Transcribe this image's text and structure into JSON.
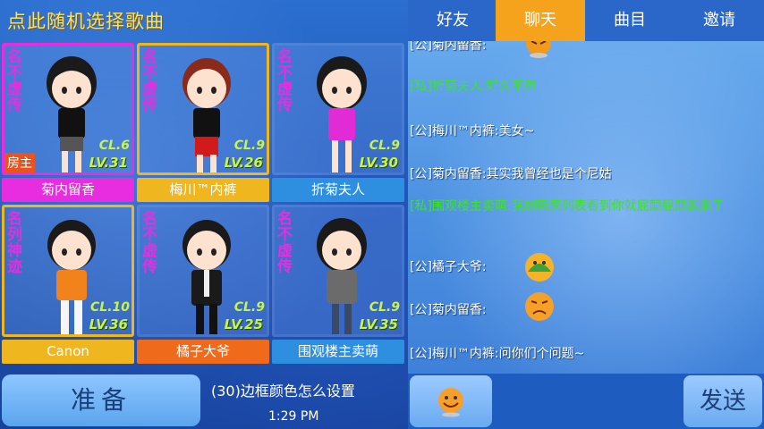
{
  "header": {
    "random_song_label": "点此随机选择歌曲"
  },
  "players": [
    {
      "vertical_tag": "名不虚传",
      "cl": "CL.6",
      "lv": "LV.31",
      "host": "房主",
      "name": "菊内留香"
    },
    {
      "vertical_tag": "名不虚传",
      "cl": "CL.9",
      "lv": "LV.26",
      "name": "梅川™内裤"
    },
    {
      "vertical_tag": "名不虚传",
      "cl": "CL.9",
      "lv": "LV.30",
      "name": "折菊夫人"
    },
    {
      "vertical_tag": "名列神迹",
      "cl": "CL.10",
      "lv": "LV.36",
      "name": "Canon"
    },
    {
      "vertical_tag": "名不虚传",
      "cl": "CL.9",
      "lv": "LV.25",
      "name": "橘子大爷"
    },
    {
      "vertical_tag": "名不虚传",
      "cl": "CL.9",
      "lv": "LV.35",
      "name": "围观楼主卖萌"
    }
  ],
  "footer": {
    "ready_label": "准备",
    "song_info": "(30)边框颜色怎么设置",
    "time": "1:29 PM"
  },
  "tabs": [
    {
      "label": "好友"
    },
    {
      "label": "聊天"
    },
    {
      "label": "曲目"
    },
    {
      "label": "邀请"
    }
  ],
  "chat": {
    "messages": [
      {
        "text": "[公]菊内留香:"
      },
      {
        "text": "[私]折菊夫人:好久不见"
      },
      {
        "text": "[公]梅川™内裤:美女~"
      },
      {
        "text": "[公]菊内留香:其实我曾经也是个尼姑"
      },
      {
        "text": "[私]围观楼主卖萌:我翻玩家列表看到你就屁颠屁颠跑来了"
      },
      {
        "text": "[公]橘子大爷:"
      },
      {
        "text": "[公]菊内留香:"
      },
      {
        "text": "[公]梅川™内裤:问你们个问题~"
      }
    ],
    "send_label": "发送"
  },
  "colors": {
    "pink": "#e82de0",
    "gold": "#f0b61f",
    "active_tab": "#f5a21c",
    "level_green": "#c7f44a",
    "chat_green": "#39e81a"
  }
}
